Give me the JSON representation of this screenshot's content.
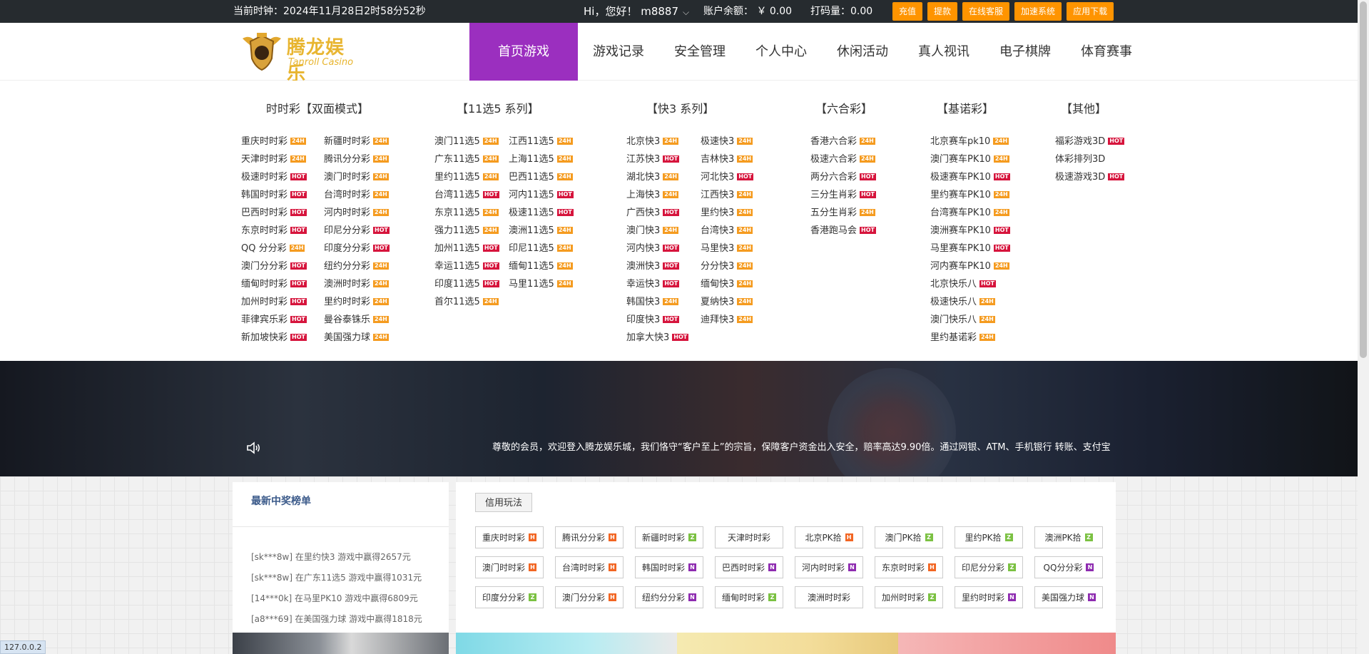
{
  "topbar": {
    "clock": "当前时钟：2024年11月28日2时58分52秒",
    "greeting": "Hi，您好！ m8887",
    "balance": "账户余额：  ￥ 0.00",
    "bet_code": "打码量：0.00",
    "buttons": [
      "充值",
      "提款",
      "在线客服",
      "加速系统",
      "应用下载"
    ]
  },
  "header": {
    "logo_text": "腾龙娱乐",
    "logo_sub": "Tanroll Casino",
    "nav": [
      "首页游戏",
      "游戏记录",
      "安全管理",
      "个人中心",
      "休闲活动",
      "真人视讯",
      "电子棋牌",
      "体育赛事"
    ],
    "active_nav": "首页游戏"
  },
  "games": {
    "columns": [
      {
        "title": "时时彩【双面模式】",
        "items": [
          [
            "重庆时时彩",
            "24H"
          ],
          [
            "天津时时彩",
            "24H"
          ],
          [
            "极速时时彩",
            "HOT"
          ],
          [
            "韩国时时彩",
            "HOT"
          ],
          [
            "巴西时时彩",
            "HOT"
          ],
          [
            "东京时时彩",
            "HOT"
          ],
          [
            "QQ 分分彩",
            "24H"
          ],
          [
            "澳门分分彩",
            "HOT"
          ],
          [
            "缅甸时时彩",
            "HOT"
          ],
          [
            "加州时时彩",
            "HOT"
          ],
          [
            "菲律宾乐彩",
            "HOT"
          ],
          [
            "新加坡快彩",
            "HOT"
          ],
          [
            "新疆时时彩",
            "24H"
          ],
          [
            "腾讯分分彩",
            "24H"
          ],
          [
            "澳门时时彩",
            "24H"
          ],
          [
            "台湾时时彩",
            "24H"
          ],
          [
            "河内时时彩",
            "24H"
          ],
          [
            "印尼分分彩",
            "HOT"
          ],
          [
            "印度分分彩",
            "HOT"
          ],
          [
            "纽约分分彩",
            "24H"
          ],
          [
            "澳洲时时彩",
            "24H"
          ],
          [
            "里约时时彩",
            "24H"
          ],
          [
            "曼谷泰铢乐",
            "24H"
          ],
          [
            "美国强力球",
            "24H"
          ]
        ]
      },
      {
        "title": "【11选5 系列】",
        "items": [
          [
            "澳门11选5",
            "24H"
          ],
          [
            "广东11选5",
            "24H"
          ],
          [
            "里约11选5",
            "24H"
          ],
          [
            "台湾11选5",
            "HOT"
          ],
          [
            "东京11选5",
            "24H"
          ],
          [
            "强力11选5",
            "24H"
          ],
          [
            "加州11选5",
            "HOT"
          ],
          [
            "幸运11选5",
            "HOT"
          ],
          [
            "印度11选5",
            "HOT"
          ],
          [
            "首尔11选5",
            "24H"
          ],
          [
            "江西11选5",
            "24H"
          ],
          [
            "上海11选5",
            "24H"
          ],
          [
            "巴西11选5",
            "24H"
          ],
          [
            "河内11选5",
            "HOT"
          ],
          [
            "极速11选5",
            "HOT"
          ],
          [
            "澳洲11选5",
            "24H"
          ],
          [
            "印尼11选5",
            "24H"
          ],
          [
            "缅甸11选5",
            "24H"
          ],
          [
            "马里11选5",
            "24H"
          ]
        ]
      },
      {
        "title": "【快3 系列】",
        "items": [
          [
            "北京快3",
            "24H"
          ],
          [
            "江苏快3",
            "HOT"
          ],
          [
            "湖北快3",
            "24H"
          ],
          [
            "上海快3",
            "24H"
          ],
          [
            "广西快3",
            "HOT"
          ],
          [
            "澳门快3",
            "24H"
          ],
          [
            "河内快3",
            "HOT"
          ],
          [
            "澳洲快3",
            "HOT"
          ],
          [
            "幸运快3",
            "HOT"
          ],
          [
            "韩国快3",
            "24H"
          ],
          [
            "印度快3",
            "HOT"
          ],
          [
            "加拿大快3",
            "HOT"
          ],
          [
            "极速快3",
            "24H"
          ],
          [
            "吉林快3",
            "24H"
          ],
          [
            "河北快3",
            "HOT"
          ],
          [
            "江西快3",
            "24H"
          ],
          [
            "里约快3",
            "24H"
          ],
          [
            "台湾快3",
            "24H"
          ],
          [
            "马里快3",
            "24H"
          ],
          [
            "分分快3",
            "24H"
          ],
          [
            "缅甸快3",
            "24H"
          ],
          [
            "夏纳快3",
            "24H"
          ],
          [
            "迪拜快3",
            "24H"
          ]
        ]
      },
      {
        "title": "【六合彩】",
        "items": [
          [
            "香港六合彩",
            "24H"
          ],
          [
            "极速六合彩",
            "24H"
          ],
          [
            "两分六合彩",
            "HOT"
          ],
          [
            "三分生肖彩",
            "HOT"
          ],
          [
            "五分生肖彩",
            "24H"
          ],
          [
            "香港跑马会",
            "HOT"
          ]
        ]
      },
      {
        "title": "【基诺彩】",
        "items": [
          [
            "北京赛车pk10",
            "24H"
          ],
          [
            "澳门赛车PK10",
            "24H"
          ],
          [
            "极速赛车PK10",
            "HOT"
          ],
          [
            "里约赛车PK10",
            "24H"
          ],
          [
            "台湾赛车PK10",
            "24H"
          ],
          [
            "澳洲赛车PK10",
            "HOT"
          ],
          [
            "马里赛车PK10",
            "HOT"
          ],
          [
            "河内赛车PK10",
            "24H"
          ],
          [
            "北京快乐八",
            "HOT"
          ],
          [
            "极速快乐八",
            "24H"
          ],
          [
            "澳门快乐八",
            "24H"
          ],
          [
            "里约基诺彩",
            "24H"
          ]
        ]
      },
      {
        "title": "【其他】",
        "items": [
          [
            "福彩游戏3D",
            "HOT"
          ],
          [
            "体彩排列3D",
            ""
          ],
          [
            "极速游戏3D",
            "HOT"
          ]
        ]
      }
    ]
  },
  "banner": {
    "notice": "尊敬的会员，欢迎登入腾龙娱乐城，我们恪守“客户至上”的宗旨，保障客户资金出入安全，赔率高达9.90倍。通过网银、ATM、手机银行 转账、支付宝"
  },
  "winners": {
    "title": "最新中奖榜单",
    "items": [
      "[sk***8w] 在里约快3 游戏中赢得2657元",
      "[sk***8w] 在广东11选5 游戏中赢得1031元",
      "[14***0k] 在马里PK10 游戏中赢得6809元",
      "[a8***69] 在美国强力球 游戏中赢得1818元"
    ]
  },
  "credit": {
    "tab": "信用玩法",
    "items": [
      [
        "重庆时时彩",
        "H"
      ],
      [
        "腾讯分分彩",
        "H"
      ],
      [
        "新疆时时彩",
        "Z"
      ],
      [
        "天津时时彩",
        ""
      ],
      [
        "北京PK拾",
        "H"
      ],
      [
        "澳门PK拾",
        "Z"
      ],
      [
        "里约PK拾",
        "Z"
      ],
      [
        "澳洲PK拾",
        "Z"
      ],
      [
        "澳门时时彩",
        "H"
      ],
      [
        "台湾时时彩",
        "H"
      ],
      [
        "韩国时时彩",
        "N"
      ],
      [
        "巴西时时彩",
        "N"
      ],
      [
        "河内时时彩",
        "N"
      ],
      [
        "东京时时彩",
        "H"
      ],
      [
        "印尼分分彩",
        "Z"
      ],
      [
        "QQ分分彩",
        "N"
      ],
      [
        "印度分分彩",
        "Z"
      ],
      [
        "澳门分分彩",
        "H"
      ],
      [
        "纽约分分彩",
        "N"
      ],
      [
        "缅甸时时彩",
        "Z"
      ],
      [
        "澳洲时时彩",
        ""
      ],
      [
        "加州时时彩",
        "Z"
      ],
      [
        "里约时时彩",
        "N"
      ],
      [
        "美国强力球",
        "N"
      ]
    ]
  },
  "status": {
    "ip": "127.0.0.2"
  },
  "colors": {
    "nav_active": "#9b2fbf",
    "topbar": "#262b2f",
    "button": "#ff9400",
    "badge_24h": "#f59b1f",
    "badge_hot": "#d6143c"
  }
}
